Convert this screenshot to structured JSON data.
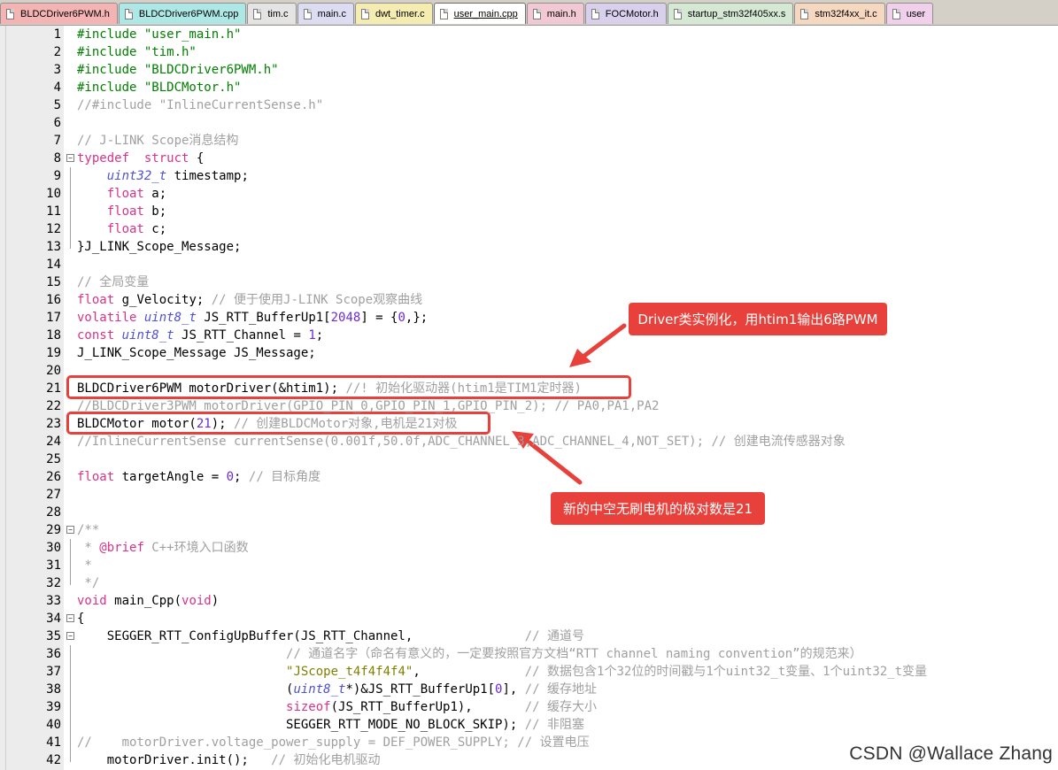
{
  "tabs": [
    {
      "label": "BLDCDriver6PWM.h",
      "color": "#f4b4b4",
      "active": false
    },
    {
      "label": "BLDCDriver6PWM.cpp",
      "color": "#aee8e6",
      "active": false
    },
    {
      "label": "tim.c",
      "color": "#e4e4e4",
      "active": false
    },
    {
      "label": "main.c",
      "color": "#dcdcf2",
      "active": false
    },
    {
      "label": "dwt_timer.c",
      "color": "#f4ecb0",
      "active": false
    },
    {
      "label": "user_main.cpp",
      "color": "#f6f0c8",
      "active": true
    },
    {
      "label": "main.h",
      "color": "#f2c8d4",
      "active": false
    },
    {
      "label": "FOCMotor.h",
      "color": "#d8d0ec",
      "active": false
    },
    {
      "label": "startup_stm32f405xx.s",
      "color": "#d4e8d4",
      "active": false
    },
    {
      "label": "stm32f4xx_it.c",
      "color": "#f6d8c0",
      "active": false
    },
    {
      "label": "user",
      "color": "#f0d0ea",
      "active": false
    }
  ],
  "code_lines": [
    {
      "n": "1",
      "t": [
        [
          "pp",
          "#include \"user_main.h\""
        ]
      ]
    },
    {
      "n": "2",
      "t": [
        [
          "pp",
          "#include \"tim.h\""
        ]
      ]
    },
    {
      "n": "3",
      "t": [
        [
          "pp",
          "#include \"BLDCDriver6PWM.h\""
        ]
      ]
    },
    {
      "n": "4",
      "t": [
        [
          "pp",
          "#include \"BLDCMotor.h\""
        ]
      ]
    },
    {
      "n": "5",
      "t": [
        [
          "cm",
          "//#include \"InlineCurrentSense.h\""
        ]
      ]
    },
    {
      "n": "6",
      "t": []
    },
    {
      "n": "7",
      "t": [
        [
          "cm",
          "// J-LINK Scope消息结构"
        ]
      ]
    },
    {
      "n": "8",
      "t": [
        [
          "kw",
          "typedef"
        ],
        [
          "",
          "  "
        ],
        [
          "kw",
          "struct"
        ],
        [
          "",
          " {"
        ]
      ]
    },
    {
      "n": "9",
      "t": [
        [
          "",
          "    "
        ],
        [
          "ty",
          "uint32_t"
        ],
        [
          "",
          " timestamp;"
        ]
      ]
    },
    {
      "n": "10",
      "t": [
        [
          "",
          "    "
        ],
        [
          "kw",
          "float"
        ],
        [
          "",
          " a;"
        ]
      ]
    },
    {
      "n": "11",
      "t": [
        [
          "",
          "    "
        ],
        [
          "kw",
          "float"
        ],
        [
          "",
          " b;"
        ]
      ]
    },
    {
      "n": "12",
      "t": [
        [
          "",
          "    "
        ],
        [
          "kw",
          "float"
        ],
        [
          "",
          " c;"
        ]
      ]
    },
    {
      "n": "13",
      "t": [
        [
          "",
          "}J_LINK_Scope_Message;"
        ]
      ]
    },
    {
      "n": "14",
      "t": []
    },
    {
      "n": "15",
      "t": [
        [
          "cm",
          "// 全局变量"
        ]
      ]
    },
    {
      "n": "16",
      "t": [
        [
          "kw",
          "float"
        ],
        [
          "",
          " g_Velocity; "
        ],
        [
          "cm",
          "// 便于使用J-LINK Scope观察曲线"
        ]
      ]
    },
    {
      "n": "17",
      "t": [
        [
          "kw",
          "volatile"
        ],
        [
          "",
          " "
        ],
        [
          "ty",
          "uint8_t"
        ],
        [
          "",
          " JS_RTT_BufferUp1["
        ],
        [
          "num",
          "2048"
        ],
        [
          "",
          "] = {"
        ],
        [
          "num",
          "0"
        ],
        [
          "",
          ",};"
        ]
      ]
    },
    {
      "n": "18",
      "t": [
        [
          "kw",
          "const"
        ],
        [
          "",
          " "
        ],
        [
          "ty",
          "uint8_t"
        ],
        [
          "",
          " JS_RTT_Channel = "
        ],
        [
          "num",
          "1"
        ],
        [
          "",
          ";"
        ]
      ]
    },
    {
      "n": "19",
      "t": [
        [
          "",
          "J_LINK_Scope_Message JS_Message;"
        ]
      ]
    },
    {
      "n": "20",
      "t": []
    },
    {
      "n": "21",
      "t": [
        [
          "",
          "BLDCDriver6PWM motorDriver(&htim1); "
        ],
        [
          "cm",
          "//! 初始化驱动器(htim1是TIM1定时器)"
        ]
      ]
    },
    {
      "n": "22",
      "t": [
        [
          "cm",
          "//BLDCDriver3PWM motorDriver(GPIO_PIN_0,GPIO_PIN_1,GPIO_PIN_2); // PA0,PA1,PA2"
        ]
      ]
    },
    {
      "n": "23",
      "t": [
        [
          "",
          "BLDCMotor motor("
        ],
        [
          "num",
          "21"
        ],
        [
          "",
          "); "
        ],
        [
          "cm",
          "// 创建BLDCMotor对象,电机是21对极"
        ]
      ]
    },
    {
      "n": "24",
      "t": [
        [
          "cm",
          "//InlineCurrentSense currentSense(0.001f,50.0f,ADC_CHANNEL_3,ADC_CHANNEL_4,NOT_SET); // 创建电流传感器对象"
        ]
      ]
    },
    {
      "n": "25",
      "t": []
    },
    {
      "n": "26",
      "t": [
        [
          "kw",
          "float"
        ],
        [
          "",
          " targetAngle = "
        ],
        [
          "num",
          "0"
        ],
        [
          "",
          "; "
        ],
        [
          "cm",
          "// 目标角度"
        ]
      ]
    },
    {
      "n": "27",
      "t": []
    },
    {
      "n": "28",
      "t": []
    },
    {
      "n": "29",
      "t": [
        [
          "cm",
          "/**"
        ]
      ]
    },
    {
      "n": "30",
      "t": [
        [
          "cm",
          " * "
        ],
        [
          "kw",
          "@brief"
        ],
        [
          "cm",
          " C++环境入口函数"
        ]
      ]
    },
    {
      "n": "31",
      "t": [
        [
          "cm",
          " *"
        ]
      ]
    },
    {
      "n": "32",
      "t": [
        [
          "cm",
          " */"
        ]
      ]
    },
    {
      "n": "33",
      "t": [
        [
          "kw",
          "void"
        ],
        [
          "",
          " main_Cpp("
        ],
        [
          "kw",
          "void"
        ],
        [
          "",
          ")"
        ]
      ]
    },
    {
      "n": "34",
      "t": [
        [
          "",
          "{"
        ]
      ]
    },
    {
      "n": "35",
      "t": [
        [
          "",
          "    SEGGER_RTT_ConfigUpBuffer(JS_RTT_Channel,               "
        ],
        [
          "cm",
          "// 通道号"
        ]
      ]
    },
    {
      "n": "36",
      "t": [
        [
          "",
          "                            "
        ],
        [
          "cm",
          "// 通道名字（命名有意义的，一定要按照官方文档“RTT channel naming convention”的规范来）"
        ]
      ]
    },
    {
      "n": "37",
      "t": [
        [
          "",
          "                            "
        ],
        [
          "str",
          "\"JScope_t4f4f4f4\""
        ],
        [
          "",
          ",              "
        ],
        [
          "cm",
          "// 数据包含1个32位的时间戳与1个uint32_t变量、1个uint32_t变量"
        ]
      ]
    },
    {
      "n": "38",
      "t": [
        [
          "",
          "                            ("
        ],
        [
          "ty",
          "uint8_t"
        ],
        [
          "",
          "*)&JS_RTT_BufferUp1["
        ],
        [
          "num",
          "0"
        ],
        [
          "",
          "], "
        ],
        [
          "cm",
          "// 缓存地址"
        ]
      ]
    },
    {
      "n": "39",
      "t": [
        [
          "",
          "                            "
        ],
        [
          "kw",
          "sizeof"
        ],
        [
          "",
          "(JS_RTT_BufferUp1),       "
        ],
        [
          "cm",
          "// 缓存大小"
        ]
      ]
    },
    {
      "n": "40",
      "t": [
        [
          "",
          "                            SEGGER_RTT_MODE_NO_BLOCK_SKIP); "
        ],
        [
          "cm",
          "// 非阻塞"
        ]
      ]
    },
    {
      "n": "41",
      "t": [
        [
          "cm",
          "//    motorDriver.voltage_power_supply = DEF_POWER_SUPPLY; // 设置电压"
        ]
      ]
    },
    {
      "n": "42",
      "t": [
        [
          "",
          "    motorDriver.init();   "
        ],
        [
          "cm",
          "// 初始化电机驱动"
        ]
      ]
    }
  ],
  "annotations": {
    "callout_driver": "Driver类实例化，用htim1输出6路PWM",
    "callout_motor": "新的中空无刷电机的极对数是21"
  },
  "watermark": "CSDN @Wallace Zhang",
  "colors": {
    "accent_red": "#e8403a",
    "gutter_bg": "#ececec",
    "comment": "#a0a0a0",
    "preprocessor": "#008000",
    "keyword": "#d9328a",
    "type": "#5050d8",
    "number": "#6a2bd8",
    "string": "#808000"
  },
  "fold_markers": [
    "8",
    "29",
    "34",
    "35"
  ],
  "icons": [
    "file-icon",
    "fold-toggle-icon"
  ]
}
